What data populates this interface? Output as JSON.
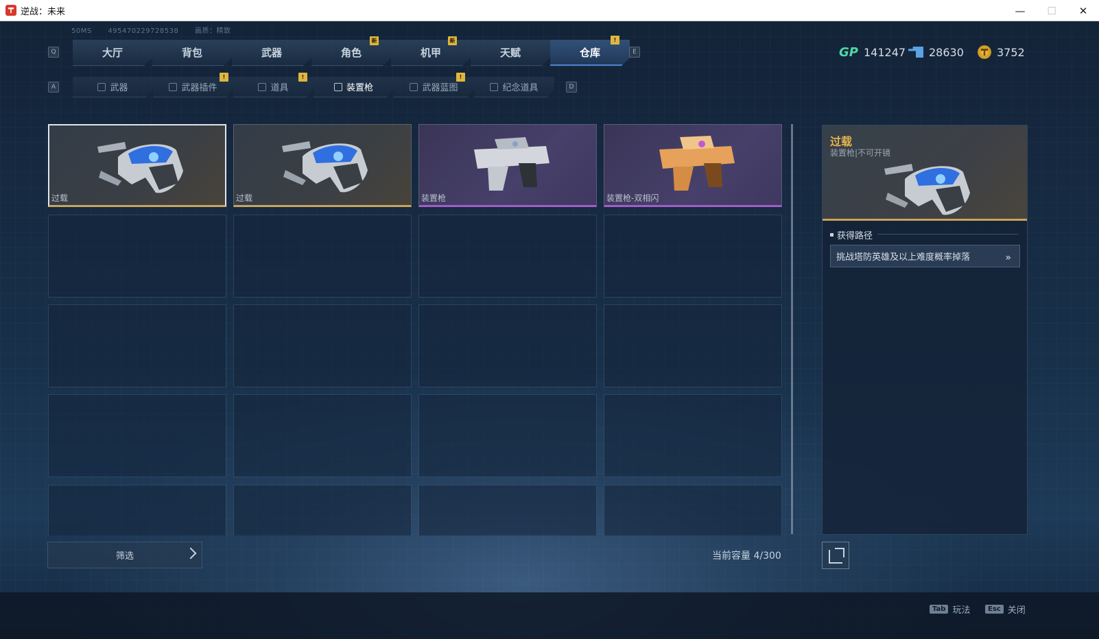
{
  "window": {
    "title": "逆战：未来",
    "minimize": "—",
    "maximize": "☐",
    "close": "✕"
  },
  "info": {
    "ping": "50MS",
    "uid": "495470229728538",
    "quality": "画质：精致"
  },
  "keys": {
    "prev_main": "Q",
    "next_main": "E",
    "prev_sub": "A",
    "next_sub": "D"
  },
  "main_tabs": [
    {
      "label": "大厅"
    },
    {
      "label": "背包"
    },
    {
      "label": "武器"
    },
    {
      "label": "角色",
      "badge": "新"
    },
    {
      "label": "机甲",
      "badge": "新"
    },
    {
      "label": "天赋"
    },
    {
      "label": "仓库",
      "badge": "!"
    }
  ],
  "sub_tabs": [
    {
      "label": "武器"
    },
    {
      "label": "武器插件",
      "badge": "!"
    },
    {
      "label": "道具",
      "badge": "!"
    },
    {
      "label": "装置枪"
    },
    {
      "label": "武器蓝图",
      "badge": "!"
    },
    {
      "label": "纪念道具"
    }
  ],
  "currency": {
    "gp_label": "GP",
    "gp": "141247",
    "ticket": "28630",
    "coin": "3752"
  },
  "items": [
    {
      "name": "过载",
      "rarity": "gold"
    },
    {
      "name": "过载",
      "rarity": "gold"
    },
    {
      "name": "装置枪",
      "rarity": "purple"
    },
    {
      "name": "装置枪-双相闪",
      "rarity": "purple"
    }
  ],
  "filter": {
    "label": "筛选"
  },
  "capacity": "当前容量 4/300",
  "detail": {
    "name": "过载",
    "subtitle": "装置枪|不可开镜",
    "section": "获得路径",
    "source": "挑战塔防英雄及以上难度概率掉落",
    "source_arrow": "»"
  },
  "hints": [
    {
      "key": "Tab",
      "label": "玩法"
    },
    {
      "key": "Esc",
      "label": "关闭"
    }
  ],
  "colors": {
    "gold": "#c9a45a",
    "purple": "#a25cc7",
    "accent": "#4d86d4",
    "title_gold": "#e6b54a"
  }
}
